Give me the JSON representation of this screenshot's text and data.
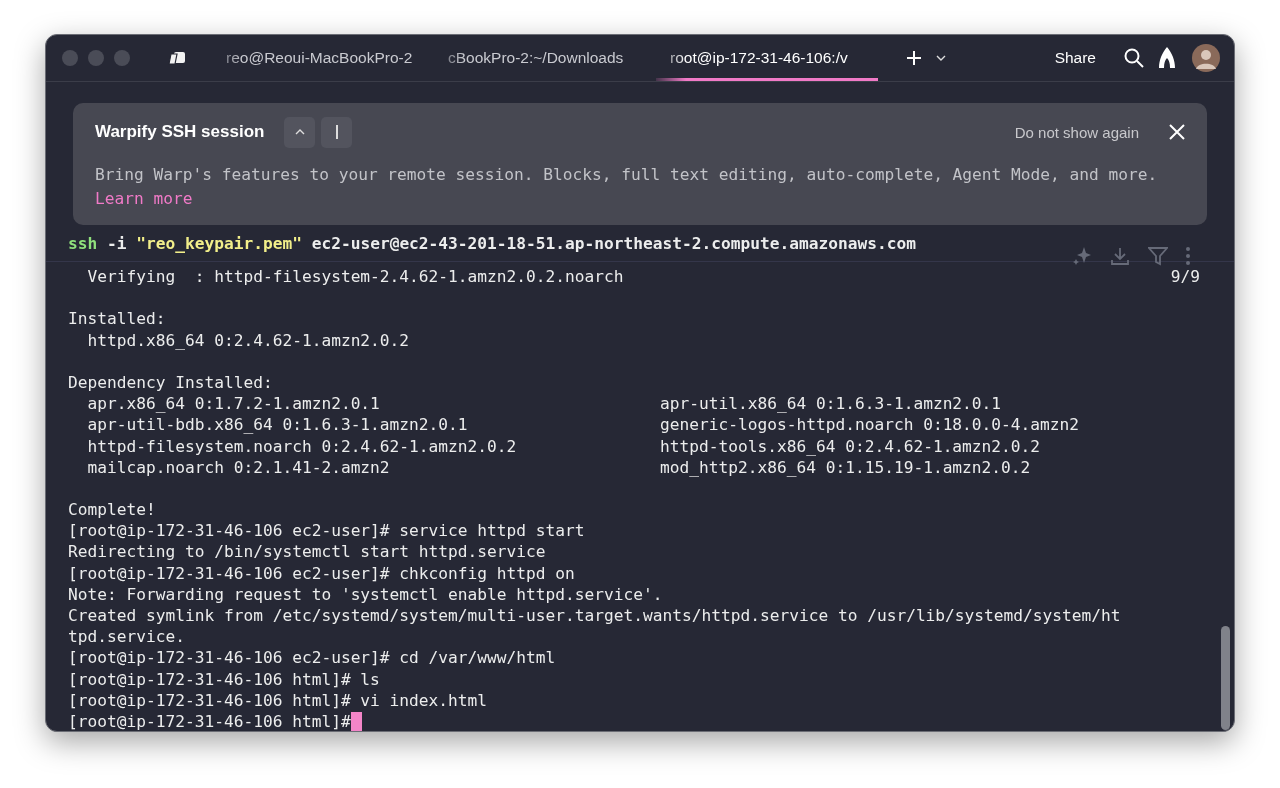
{
  "tabs": [
    {
      "label": "reo@Reoui-MacBookPro-2",
      "selected": false
    },
    {
      "label": "cBookPro-2:~/Downloads",
      "selected": false
    },
    {
      "label": "root@ip-172-31-46-106:/v",
      "selected": true
    }
  ],
  "toolbar": {
    "share": "Share"
  },
  "banner": {
    "title": "Warpify SSH session",
    "dismiss": "Do not show again",
    "body": "Bring Warp's features to your remote session. Blocks, full text editing, auto-complete, Agent Mode, and more.",
    "link": "Learn more"
  },
  "block": {
    "command": {
      "program": "ssh",
      "flag": "-i",
      "keyfile": "\"reo_keypair.pem\"",
      "host": "ec2-user@ec2-43-201-18-51.ap-northeast-2.compute.amazonaws.com"
    },
    "lines": [
      {
        "kind": "progress",
        "text": "  Verifying  : httpd-filesystem-2.4.62-1.amzn2.0.2.noarch",
        "counter": "9/9"
      },
      {
        "kind": "blank"
      },
      {
        "kind": "text",
        "text": "Installed:"
      },
      {
        "kind": "text",
        "text": "  httpd.x86_64 0:2.4.62-1.amzn2.0.2"
      },
      {
        "kind": "blank"
      },
      {
        "kind": "text",
        "text": "Dependency Installed:"
      },
      {
        "kind": "columns",
        "cells": [
          "  apr.x86_64 0:1.7.2-1.amzn2.0.1",
          "apr-util.x86_64 0:1.6.3-1.amzn2.0.1"
        ]
      },
      {
        "kind": "columns",
        "cells": [
          "  apr-util-bdb.x86_64 0:1.6.3-1.amzn2.0.1",
          "generic-logos-httpd.noarch 0:18.0.0-4.amzn2"
        ]
      },
      {
        "kind": "columns",
        "cells": [
          "  httpd-filesystem.noarch 0:2.4.62-1.amzn2.0.2",
          "httpd-tools.x86_64 0:2.4.62-1.amzn2.0.2"
        ]
      },
      {
        "kind": "columns",
        "cells": [
          "  mailcap.noarch 0:2.1.41-2.amzn2",
          "mod_http2.x86_64 0:1.15.19-1.amzn2.0.2"
        ]
      },
      {
        "kind": "blank"
      },
      {
        "kind": "text",
        "text": "Complete!"
      },
      {
        "kind": "text",
        "text": "[root@ip-172-31-46-106 ec2-user]# service httpd start"
      },
      {
        "kind": "text",
        "text": "Redirecting to /bin/systemctl start httpd.service"
      },
      {
        "kind": "text",
        "text": "[root@ip-172-31-46-106 ec2-user]# chkconfig httpd on"
      },
      {
        "kind": "text",
        "text": "Note: Forwarding request to 'systemctl enable httpd.service'."
      },
      {
        "kind": "text",
        "text": "Created symlink from /etc/systemd/system/multi-user.target.wants/httpd.service to /usr/lib/systemd/system/ht"
      },
      {
        "kind": "text",
        "text": "tpd.service."
      },
      {
        "kind": "text",
        "text": "[root@ip-172-31-46-106 ec2-user]# cd /var/www/html"
      },
      {
        "kind": "text",
        "text": "[root@ip-172-31-46-106 html]# ls"
      },
      {
        "kind": "text",
        "text": "[root@ip-172-31-46-106 html]# vi index.html"
      },
      {
        "kind": "prompt",
        "text": "[root@ip-172-31-46-106 html]#"
      }
    ]
  }
}
